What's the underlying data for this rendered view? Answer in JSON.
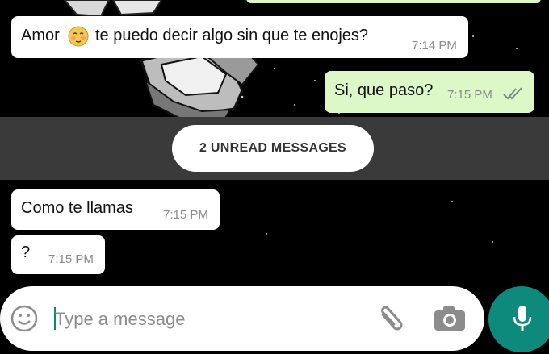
{
  "messages": [
    {
      "direction": "incoming",
      "text_before_emoji": "Amor",
      "emoji": "blushing-face-emoji",
      "text_after_emoji": "te puedo decir algo sin que te enojes?",
      "time": "7:14 PM"
    },
    {
      "direction": "outgoing",
      "text": "Si, que paso?",
      "time": "7:15 PM",
      "status": "read-double-check"
    },
    {
      "direction": "incoming",
      "text": "Como te llamas",
      "time": "7:15 PM"
    },
    {
      "direction": "incoming",
      "text": "?",
      "time": "7:15 PM"
    }
  ],
  "unread_banner": {
    "label": "2 UNREAD MESSAGES"
  },
  "composer": {
    "placeholder": "Type a message",
    "emoji_icon": "smiley-icon",
    "attach_icon": "paperclip-icon",
    "camera_icon": "camera-icon",
    "mic_icon": "microphone-icon"
  },
  "colors": {
    "incoming_bubble": "#ffffff",
    "outgoing_bubble": "#dcf8c6",
    "accent": "#0e8a7c",
    "read_ticks": "#7a8a8a",
    "chat_background": "#000000"
  }
}
